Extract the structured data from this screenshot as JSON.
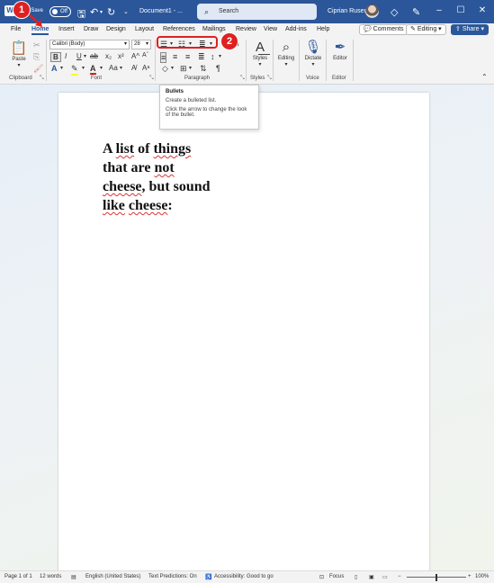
{
  "titlebar": {
    "autosave_label": "AutoSave",
    "autosave_state": "Off",
    "document_title": "Document1 - ...",
    "search_placeholder": "Search",
    "user_name": "Ciprian Rusen"
  },
  "tabs": [
    "File",
    "Home",
    "Insert",
    "Draw",
    "Design",
    "Layout",
    "References",
    "Mailings",
    "Review",
    "View",
    "Add-ins",
    "Help"
  ],
  "tab_buttons": {
    "comments": "Comments",
    "editing": "Editing",
    "share": "Share"
  },
  "ribbon": {
    "clipboard": {
      "paste": "Paste",
      "label": "Clipboard"
    },
    "font": {
      "name": "Calibri (Body)",
      "size": "28",
      "label": "Font"
    },
    "paragraph": {
      "label": "Paragraph"
    },
    "styles": {
      "button": "Styles",
      "label": "Styles"
    },
    "editing": {
      "button": "Editing"
    },
    "voice": {
      "button": "Dictate",
      "label": "Voice"
    },
    "editor": {
      "button": "Editor",
      "label": "Editor"
    }
  },
  "tooltip": {
    "title": "Bullets",
    "desc": "Create a bulleted list.",
    "hint": "Click the arrow to change the look of the bullet."
  },
  "document": {
    "lines": [
      "A list of things",
      "that are not",
      "cheese, but sound",
      "like cheese:"
    ]
  },
  "statusbar": {
    "page": "Page 1 of 1",
    "words": "12 words",
    "language": "English (United States)",
    "predictions": "Text Predictions: On",
    "accessibility": "Accessibility: Good to go",
    "focus": "Focus",
    "zoom": "100%"
  },
  "callouts": [
    "1",
    "2"
  ],
  "colors": {
    "accent": "#2b579a",
    "callout": "#e02020",
    "highlight": "#ffff00",
    "font_color": "#e02020"
  }
}
